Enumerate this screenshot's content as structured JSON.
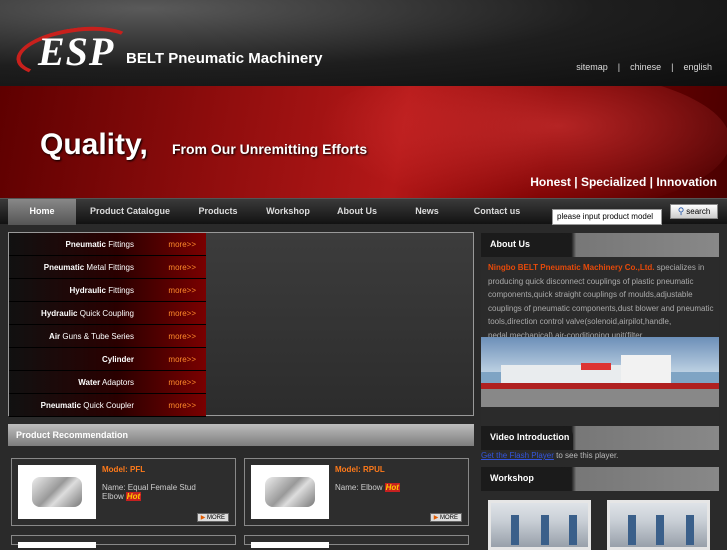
{
  "header": {
    "brand_letters": "ESP",
    "brand_name": "BELT Pneumatic Machinery",
    "top_links": [
      "sitemap",
      "|",
      "chinese",
      "|",
      "english"
    ]
  },
  "banner": {
    "slogan_big": "Quality,",
    "slogan_small": "From Our Unremitting Efforts",
    "values": "Honest | Specialized  | Innovation"
  },
  "nav": {
    "items": [
      "Home",
      "Product Catalogue",
      "Products",
      "Workshop",
      "About Us",
      "News",
      "Contact us"
    ],
    "active": "Home"
  },
  "search": {
    "placeholder": "please input product model",
    "button": "search"
  },
  "categories": [
    {
      "bold": "Pneumatic",
      "rest": " Fittings",
      "more": "more>>"
    },
    {
      "bold": "Pneumatic",
      "rest": " Metal Fittings",
      "more": "more>>"
    },
    {
      "bold": "Hydraulic",
      "rest": " Fittings",
      "more": "more>>"
    },
    {
      "bold": "Hydraulic",
      "rest": " Quick Coupling",
      "more": "more>>"
    },
    {
      "bold": "Air",
      "rest": " Guns & Tube Series",
      "more": "more>>"
    },
    {
      "bold": "Cylinder",
      "rest": "",
      "more": "more>>"
    },
    {
      "bold": "Water",
      "rest": " Adaptors",
      "more": "more>>"
    },
    {
      "bold": "Pneumatic",
      "rest": " Quick Coupler",
      "more": "more>>"
    }
  ],
  "recommend": {
    "title": "Product Recommendation",
    "products": [
      {
        "model": "Model: PFL",
        "name": "Name: Equal Female Stud Elbow",
        "hot": "Hot",
        "more": "MORE"
      },
      {
        "model": "Model: RPUL",
        "name": "Name: Elbow",
        "hot": "Hot",
        "more": "MORE"
      }
    ]
  },
  "about": {
    "title": "About Us",
    "company": "Ningbo BELT Pneumatic Machinery Co.,Ltd.",
    "text": " specializes in producing quick disconnect couplings of plastic pneumatic components,quick straight couplings of moulds,adjustable couplings of pneumatic components,dust blower and pneumatic tools,direction control valve(solenoid,airpilot,handle, pedal,mechanical),air-conditioning unit(filter, regulator,ubricator)......"
  },
  "video": {
    "title": "Video Introduction",
    "link": "Get the Flash Player",
    "rest": " to see this player."
  },
  "workshop": {
    "title": "Workshop"
  },
  "colors": {
    "accent": "#e64a0a",
    "more": "#ff8a2a",
    "banner": "#a01010"
  }
}
